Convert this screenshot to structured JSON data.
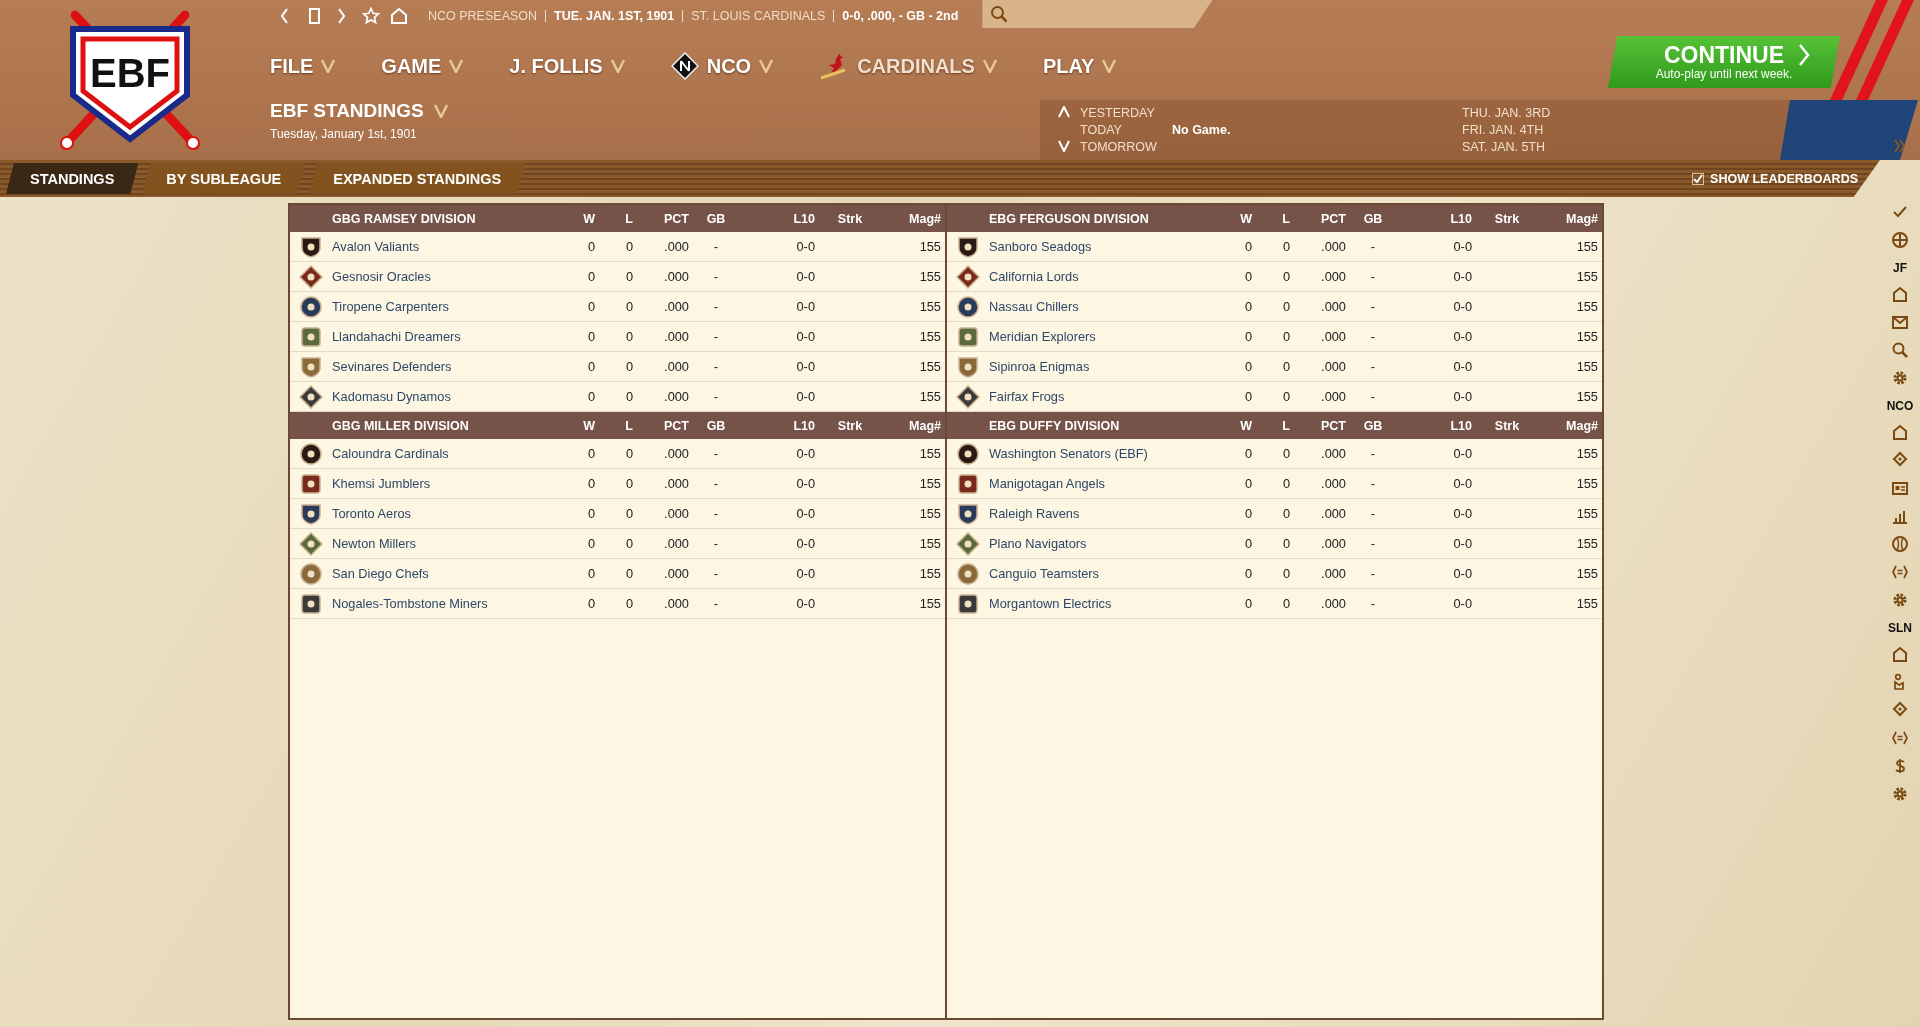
{
  "logo": {
    "text": "EBF"
  },
  "topbar": {
    "crumbs": [
      {
        "text": "NCO PRESEASON",
        "kind": "muted"
      },
      {
        "text": "TUE. JAN. 1ST, 1901",
        "kind": "strong"
      },
      {
        "text": "ST. LOUIS CARDINALS",
        "kind": "muted"
      },
      {
        "text": "0-0, .000, - GB - 2nd",
        "kind": "strong"
      }
    ]
  },
  "menus": [
    {
      "label": "FILE",
      "kind": "plain"
    },
    {
      "label": "GAME",
      "kind": "plain"
    },
    {
      "label": "J. FOLLIS",
      "kind": "plain"
    },
    {
      "label": "NCO",
      "kind": "league"
    },
    {
      "label": "CARDINALS",
      "kind": "team"
    },
    {
      "label": "PLAY",
      "kind": "plain"
    }
  ],
  "page": {
    "title": "EBF STANDINGS",
    "date": "Tuesday, January 1st, 1901"
  },
  "continue_button": {
    "label": "CONTINUE",
    "sublabel": "Auto-play until next week."
  },
  "schedule": {
    "days": [
      {
        "label": "YESTERDAY",
        "kind": "earlier"
      },
      {
        "label": "TODAY",
        "kind": "current",
        "game": "No Game."
      },
      {
        "label": "TOMORROW",
        "kind": "later"
      }
    ],
    "upcoming": [
      "THU. JAN. 3RD",
      "FRI. JAN. 4TH",
      "SAT. JAN. 5TH"
    ]
  },
  "tabs": [
    {
      "label": "STANDINGS",
      "selected": true
    },
    {
      "label": "BY SUBLEAGUE",
      "selected": false
    },
    {
      "label": "EXPANDED STANDINGS",
      "selected": false
    }
  ],
  "show_leaderboards": {
    "label": "SHOW LEADERBOARDS",
    "checked": true
  },
  "panels": [
    {
      "divisions": [
        {
          "name": "GBG RAMSEY DIVISION",
          "columns": [
            "W",
            "L",
            "PCT",
            "GB",
            "L10",
            "Strk",
            "Mag#"
          ],
          "teams": [
            {
              "name": "Avalon Valiants",
              "w": "0",
              "l": "0",
              "pct": ".000",
              "gb": "-",
              "l10": "0-0",
              "mag": "155"
            },
            {
              "name": "Gesnosir Oracles",
              "w": "0",
              "l": "0",
              "pct": ".000",
              "gb": "-",
              "l10": "0-0",
              "mag": "155"
            },
            {
              "name": "Tiropene Carpenters",
              "w": "0",
              "l": "0",
              "pct": ".000",
              "gb": "-",
              "l10": "0-0",
              "mag": "155"
            },
            {
              "name": "Llandahachi Dreamers",
              "w": "0",
              "l": "0",
              "pct": ".000",
              "gb": "-",
              "l10": "0-0",
              "mag": "155"
            },
            {
              "name": "Sevinares Defenders",
              "w": "0",
              "l": "0",
              "pct": ".000",
              "gb": "-",
              "l10": "0-0",
              "mag": "155"
            },
            {
              "name": "Kadomasu Dynamos",
              "w": "0",
              "l": "0",
              "pct": ".000",
              "gb": "-",
              "l10": "0-0",
              "mag": "155"
            }
          ]
        },
        {
          "name": "GBG MILLER DIVISION",
          "columns": [
            "W",
            "L",
            "PCT",
            "GB",
            "L10",
            "Strk",
            "Mag#"
          ],
          "teams": [
            {
              "name": "Caloundra Cardinals",
              "w": "0",
              "l": "0",
              "pct": ".000",
              "gb": "-",
              "l10": "0-0",
              "mag": "155"
            },
            {
              "name": "Khemsi Jumblers",
              "w": "0",
              "l": "0",
              "pct": ".000",
              "gb": "-",
              "l10": "0-0",
              "mag": "155"
            },
            {
              "name": "Toronto Aeros",
              "w": "0",
              "l": "0",
              "pct": ".000",
              "gb": "-",
              "l10": "0-0",
              "mag": "155"
            },
            {
              "name": "Newton Millers",
              "w": "0",
              "l": "0",
              "pct": ".000",
              "gb": "-",
              "l10": "0-0",
              "mag": "155"
            },
            {
              "name": "San Diego Chefs",
              "w": "0",
              "l": "0",
              "pct": ".000",
              "gb": "-",
              "l10": "0-0",
              "mag": "155"
            },
            {
              "name": "Nogales-Tombstone Miners",
              "w": "0",
              "l": "0",
              "pct": ".000",
              "gb": "-",
              "l10": "0-0",
              "mag": "155"
            }
          ]
        }
      ]
    },
    {
      "divisions": [
        {
          "name": "EBG FERGUSON DIVISION",
          "columns": [
            "W",
            "L",
            "PCT",
            "GB",
            "L10",
            "Strk",
            "Mag#"
          ],
          "teams": [
            {
              "name": "Sanboro Seadogs",
              "w": "0",
              "l": "0",
              "pct": ".000",
              "gb": "-",
              "l10": "0-0",
              "mag": "155"
            },
            {
              "name": "California Lords",
              "w": "0",
              "l": "0",
              "pct": ".000",
              "gb": "-",
              "l10": "0-0",
              "mag": "155"
            },
            {
              "name": "Nassau Chillers",
              "w": "0",
              "l": "0",
              "pct": ".000",
              "gb": "-",
              "l10": "0-0",
              "mag": "155"
            },
            {
              "name": "Meridian Explorers",
              "w": "0",
              "l": "0",
              "pct": ".000",
              "gb": "-",
              "l10": "0-0",
              "mag": "155"
            },
            {
              "name": "Sipinroa Enigmas",
              "w": "0",
              "l": "0",
              "pct": ".000",
              "gb": "-",
              "l10": "0-0",
              "mag": "155"
            },
            {
              "name": "Fairfax Frogs",
              "w": "0",
              "l": "0",
              "pct": ".000",
              "gb": "-",
              "l10": "0-0",
              "mag": "155"
            }
          ]
        },
        {
          "name": "EBG DUFFY DIVISION",
          "columns": [
            "W",
            "L",
            "PCT",
            "GB",
            "L10",
            "Strk",
            "Mag#"
          ],
          "teams": [
            {
              "name": "Washington Senators (EBF)",
              "w": "0",
              "l": "0",
              "pct": ".000",
              "gb": "-",
              "l10": "0-0",
              "mag": "155"
            },
            {
              "name": "Manigotagan Angels",
              "w": "0",
              "l": "0",
              "pct": ".000",
              "gb": "-",
              "l10": "0-0",
              "mag": "155"
            },
            {
              "name": "Raleigh Ravens",
              "w": "0",
              "l": "0",
              "pct": ".000",
              "gb": "-",
              "l10": "0-0",
              "mag": "155"
            },
            {
              "name": "Plano Navigators",
              "w": "0",
              "l": "0",
              "pct": ".000",
              "gb": "-",
              "l10": "0-0",
              "mag": "155"
            },
            {
              "name": "Canguio Teamsters",
              "w": "0",
              "l": "0",
              "pct": ".000",
              "gb": "-",
              "l10": "0-0",
              "mag": "155"
            },
            {
              "name": "Morgantown Electrics",
              "w": "0",
              "l": "0",
              "pct": ".000",
              "gb": "-",
              "l10": "0-0",
              "mag": "155"
            }
          ]
        }
      ]
    }
  ],
  "sidebar": [
    {
      "icons": [
        {
          "kind": "check"
        },
        {
          "kind": "globe"
        }
      ]
    },
    {
      "label": "JF",
      "icons": [
        {
          "kind": "home"
        },
        {
          "kind": "mail"
        },
        {
          "kind": "search"
        },
        {
          "kind": "gear"
        }
      ]
    },
    {
      "label": "NCO",
      "icons": [
        {
          "kind": "home"
        },
        {
          "kind": "pin"
        },
        {
          "kind": "card"
        },
        {
          "kind": "chart"
        },
        {
          "kind": "ball"
        },
        {
          "kind": "brackets"
        },
        {
          "kind": "gear"
        }
      ]
    },
    {
      "label": "SLN",
      "icons": [
        {
          "kind": "home"
        },
        {
          "kind": "person"
        },
        {
          "kind": "pin"
        },
        {
          "kind": "brackets"
        },
        {
          "kind": "dollar"
        },
        {
          "kind": "gear"
        }
      ]
    }
  ]
}
